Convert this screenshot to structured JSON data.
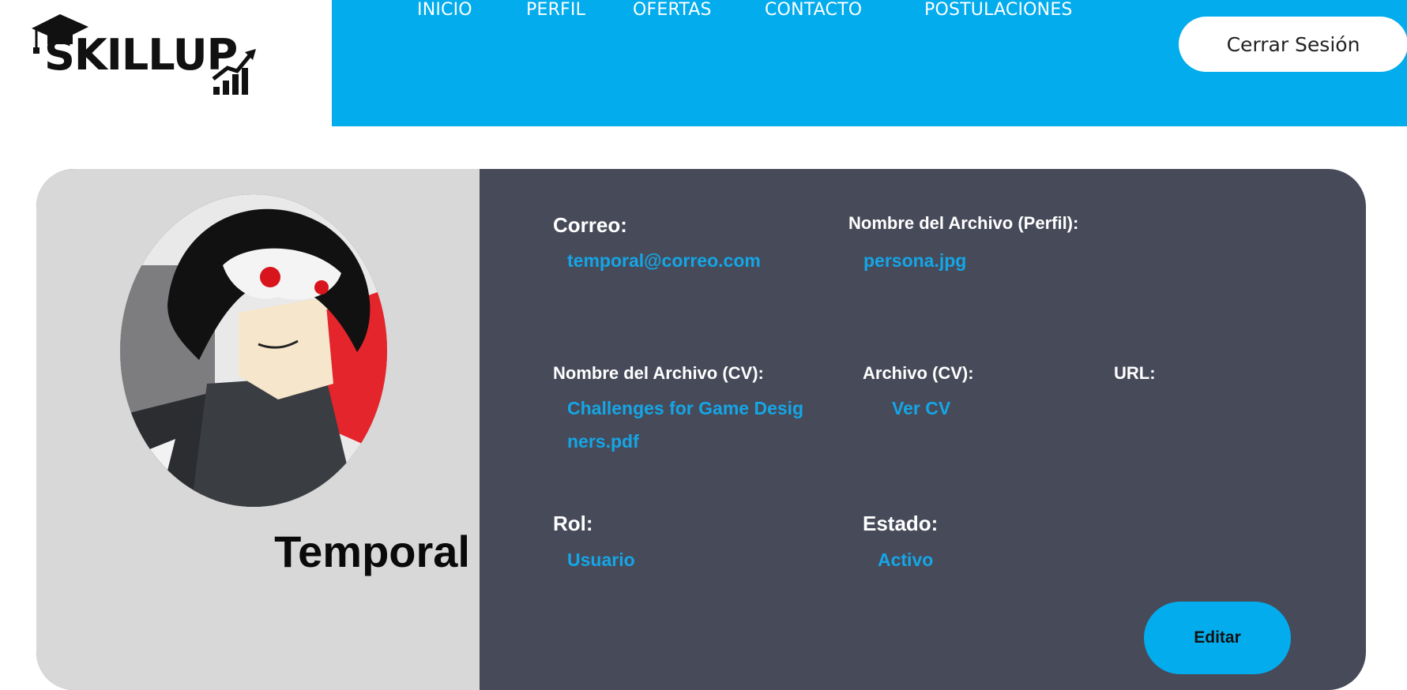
{
  "brand": {
    "name": "SKILLUP"
  },
  "nav": {
    "items": [
      {
        "label": "INICIO"
      },
      {
        "label": "PERFIL"
      },
      {
        "label": "OFERTAS"
      },
      {
        "label": "CONTACTO"
      },
      {
        "label": "POSTULACIONES"
      }
    ],
    "logout_label": "Cerrar Sesión"
  },
  "profile": {
    "name": "Temporal",
    "fields": {
      "email": {
        "label": "Correo:",
        "value": "temporal@correo.com"
      },
      "profile_file": {
        "label": "Nombre del Archivo (Perfil):",
        "value": "persona.jpg"
      },
      "cv_file": {
        "label": "Nombre del Archivo (CV):",
        "value": "Challenges for Game Designers.pdf"
      },
      "cv_link": {
        "label": "Archivo (CV):",
        "value": "Ver CV"
      },
      "url": {
        "label": "URL:",
        "value": ""
      },
      "role": {
        "label": "Rol:",
        "value": "Usuario"
      },
      "status": {
        "label": "Estado:",
        "value": "Activo"
      }
    },
    "edit_label": "Editar"
  },
  "colors": {
    "accent": "#03aced",
    "panel": "#474a59",
    "panel_left": "#d8d8d9",
    "value_text": "#14a6e6"
  }
}
